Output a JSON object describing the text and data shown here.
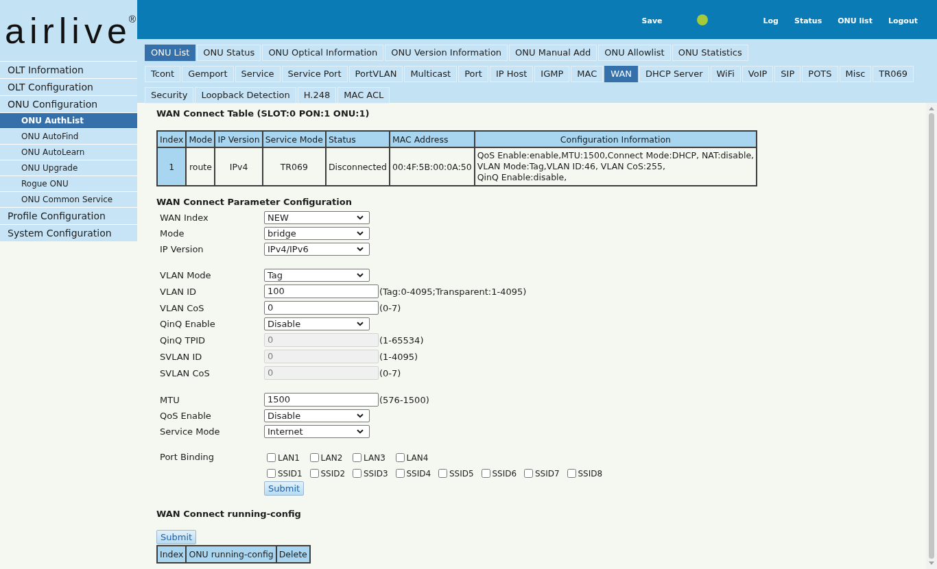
{
  "logo": {
    "text": "airlive$^{®}$"
  },
  "header": {
    "save": "Save",
    "links": [
      "Log",
      "Status",
      "ONU list",
      "Logout"
    ]
  },
  "sidebar": {
    "items": [
      {
        "label": "OLT Information",
        "selected": false
      },
      {
        "label": "OLT Configuration",
        "selected": false
      },
      {
        "label": "ONU Configuration",
        "selected": false,
        "children": [
          {
            "label": "ONU AuthList",
            "selected": true
          },
          {
            "label": "ONU AutoFind",
            "selected": false
          },
          {
            "label": "ONU AutoLearn",
            "selected": false
          },
          {
            "label": "ONU Upgrade",
            "selected": false
          },
          {
            "label": "Rogue ONU",
            "selected": false
          },
          {
            "label": "ONU Common Service",
            "selected": false
          }
        ]
      },
      {
        "label": "Profile Configuration",
        "selected": false
      },
      {
        "label": "System Configuration",
        "selected": false
      }
    ]
  },
  "tabs": [
    {
      "label": "ONU List",
      "selected": true
    },
    {
      "label": "ONU Status",
      "selected": false
    },
    {
      "label": "ONU Optical Information",
      "selected": false
    },
    {
      "label": "ONU Version Information",
      "selected": false
    },
    {
      "label": "ONU Manual Add",
      "selected": false
    },
    {
      "label": "ONU Allowlist",
      "selected": false
    },
    {
      "label": "ONU Statistics",
      "selected": false
    }
  ],
  "subtabs": [
    {
      "label": "Tcont",
      "selected": false
    },
    {
      "label": "Gemport",
      "selected": false
    },
    {
      "label": "Service",
      "selected": false
    },
    {
      "label": "Service Port",
      "selected": false
    },
    {
      "label": "PortVLAN",
      "selected": false
    },
    {
      "label": "Multicast",
      "selected": false
    },
    {
      "label": "Port",
      "selected": false
    },
    {
      "label": "IP Host",
      "selected": false
    },
    {
      "label": "IGMP",
      "selected": false
    },
    {
      "label": "MAC",
      "selected": false
    },
    {
      "label": "WAN",
      "selected": true
    },
    {
      "label": "DHCP Server",
      "selected": false
    },
    {
      "label": "WiFi",
      "selected": false
    },
    {
      "label": "VoIP",
      "selected": false
    },
    {
      "label": "SIP",
      "selected": false
    },
    {
      "label": "POTS",
      "selected": false
    },
    {
      "label": "Misc",
      "selected": false
    },
    {
      "label": "TR069",
      "selected": false
    },
    {
      "label": "Security",
      "selected": false
    },
    {
      "label": "Loopback Detection",
      "selected": false
    },
    {
      "label": "H.248",
      "selected": false
    },
    {
      "label": "MAC ACL",
      "selected": false
    }
  ],
  "wan_table": {
    "title": "WAN Connect Table (SLOT:0 PON:1 ONU:1)",
    "columns": [
      "Index",
      "Mode",
      "IP Version",
      "Service Mode",
      "Status",
      "MAC Address",
      "Configuration Information"
    ],
    "rows": [
      [
        "1",
        "route",
        "IPv4",
        "TR069",
        "Disconnected",
        "00:4F:5B:00:0A:50",
        "QoS Enable:enable,MTU:1500,Connect Mode:DHCP, NAT:disable,\nVLAN Mode:Tag,VLAN ID:46, VLAN CoS:255,\nQinQ Enable:disable,"
      ]
    ]
  },
  "config": {
    "title": "WAN Connect Parameter Configuration",
    "groups": [
      [
        {
          "label": "WAN Index",
          "kind": "select",
          "value": "NEW",
          "disabled": false
        },
        {
          "label": "Mode",
          "kind": "select",
          "value": "bridge",
          "disabled": false
        },
        {
          "label": "IP Version",
          "kind": "select",
          "value": "IPv4/IPv6",
          "disabled": false
        }
      ],
      [
        {
          "label": "VLAN Mode",
          "kind": "select",
          "value": "Tag",
          "disabled": false
        },
        {
          "label": "VLAN ID",
          "kind": "input",
          "value": "100",
          "hint": "(Tag:0-4095;Transparent:1-4095)",
          "disabled": false
        },
        {
          "label": "VLAN CoS",
          "kind": "input",
          "value": "0",
          "hint": "(0-7)",
          "disabled": false
        },
        {
          "label": "QinQ Enable",
          "kind": "select",
          "value": "Disable",
          "disabled": false
        },
        {
          "label": "QinQ TPID",
          "kind": "input",
          "value": "0",
          "hint": "(1-65534)",
          "disabled": true
        },
        {
          "label": "SVLAN ID",
          "kind": "input",
          "value": "0",
          "hint": "(1-4095)",
          "disabled": true
        },
        {
          "label": "SVLAN CoS",
          "kind": "input",
          "value": "0",
          "hint": "(0-7)",
          "disabled": true
        }
      ],
      [
        {
          "label": "MTU",
          "kind": "input",
          "value": "1500",
          "hint": "(576-1500)",
          "disabled": false
        },
        {
          "label": "QoS Enable",
          "kind": "select",
          "value": "Disable",
          "disabled": false
        },
        {
          "label": "Service Mode",
          "kind": "select",
          "value": "Internet",
          "disabled": false
        }
      ]
    ],
    "port_binding": {
      "label": "Port Binding",
      "rows": [
        [
          {
            "label": "LAN1",
            "checked": false
          },
          {
            "label": "LAN2",
            "checked": false
          },
          {
            "label": "LAN3",
            "checked": false
          },
          {
            "label": "LAN4",
            "checked": false
          }
        ],
        [
          {
            "label": "SSID1",
            "checked": false
          },
          {
            "label": "SSID2",
            "checked": false
          },
          {
            "label": "SSID3",
            "checked": false
          },
          {
            "label": "SSID4",
            "checked": false
          },
          {
            "label": "SSID5",
            "checked": false
          },
          {
            "label": "SSID6",
            "checked": false
          },
          {
            "label": "SSID7",
            "checked": false
          },
          {
            "label": "SSID8",
            "checked": false
          }
        ]
      ]
    },
    "submit": "Submit"
  },
  "running_config": {
    "title": "WAN Connect running-config",
    "submit": "Submit",
    "columns": [
      "Index",
      "ONU running-config",
      "Delete"
    ]
  }
}
